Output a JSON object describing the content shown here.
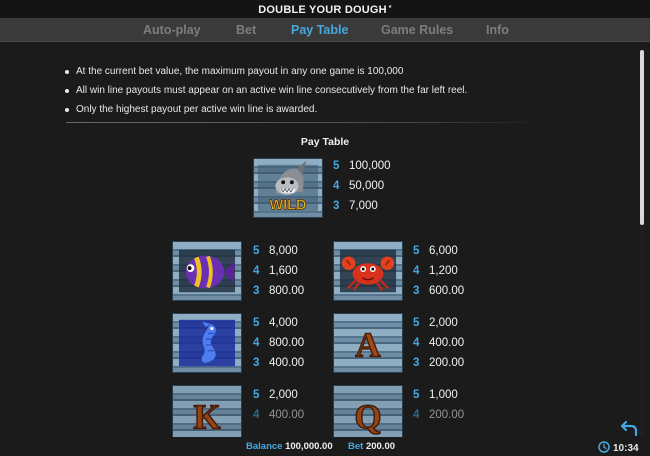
{
  "header": {
    "title": "DOUBLE YOUR DOUGH",
    "title_mark": "*"
  },
  "tabs": [
    {
      "label": "Auto-play",
      "active": false
    },
    {
      "label": "Bet",
      "active": false
    },
    {
      "label": "Pay Table",
      "active": true
    },
    {
      "label": "Game Rules",
      "active": false
    },
    {
      "label": "Info",
      "active": false
    }
  ],
  "rules": [
    "At the current bet value, the maximum payout in any one game is 100,000",
    "All win line payouts must appear on an active win line consecutively from the far left reel.",
    "Only the highest payout per active win line is awarded."
  ],
  "paytable": {
    "heading": "Pay Table",
    "wild": {
      "icon": "wild-shark-icon",
      "label": "WILD",
      "pays": [
        {
          "count": "5",
          "amount": "100,000"
        },
        {
          "count": "4",
          "amount": "50,000"
        },
        {
          "count": "3",
          "amount": "7,000"
        }
      ]
    },
    "symbols": [
      {
        "icon": "purple-fish-icon",
        "pays": [
          {
            "count": "5",
            "amount": "8,000"
          },
          {
            "count": "4",
            "amount": "1,600"
          },
          {
            "count": "3",
            "amount": "800.00"
          }
        ]
      },
      {
        "icon": "red-crab-icon",
        "pays": [
          {
            "count": "5",
            "amount": "6,000"
          },
          {
            "count": "4",
            "amount": "1,200"
          },
          {
            "count": "3",
            "amount": "600.00"
          }
        ]
      },
      {
        "icon": "seahorse-icon",
        "pays": [
          {
            "count": "5",
            "amount": "4,000"
          },
          {
            "count": "4",
            "amount": "800.00"
          },
          {
            "count": "3",
            "amount": "400.00"
          }
        ]
      },
      {
        "icon": "letter-a-icon",
        "label": "A",
        "pays": [
          {
            "count": "5",
            "amount": "2,000"
          },
          {
            "count": "4",
            "amount": "400.00"
          },
          {
            "count": "3",
            "amount": "200.00"
          }
        ]
      },
      {
        "icon": "letter-k-icon",
        "label": "K",
        "pays": [
          {
            "count": "5",
            "amount": "2,000"
          },
          {
            "count": "4",
            "amount": "400.00"
          }
        ]
      },
      {
        "icon": "letter-q-icon",
        "label": "Q",
        "pays": [
          {
            "count": "5",
            "amount": "1,000"
          },
          {
            "count": "4",
            "amount": "200.00"
          }
        ]
      }
    ]
  },
  "footer": {
    "balance_label": "Balance",
    "balance_value": "100,000.00",
    "bet_label": "Bet",
    "bet_value": "200.00",
    "time": "10:34"
  },
  "colors": {
    "accent": "#46a8e0",
    "background": "#1b1b1b",
    "tabbar": "#3a3a3a"
  }
}
